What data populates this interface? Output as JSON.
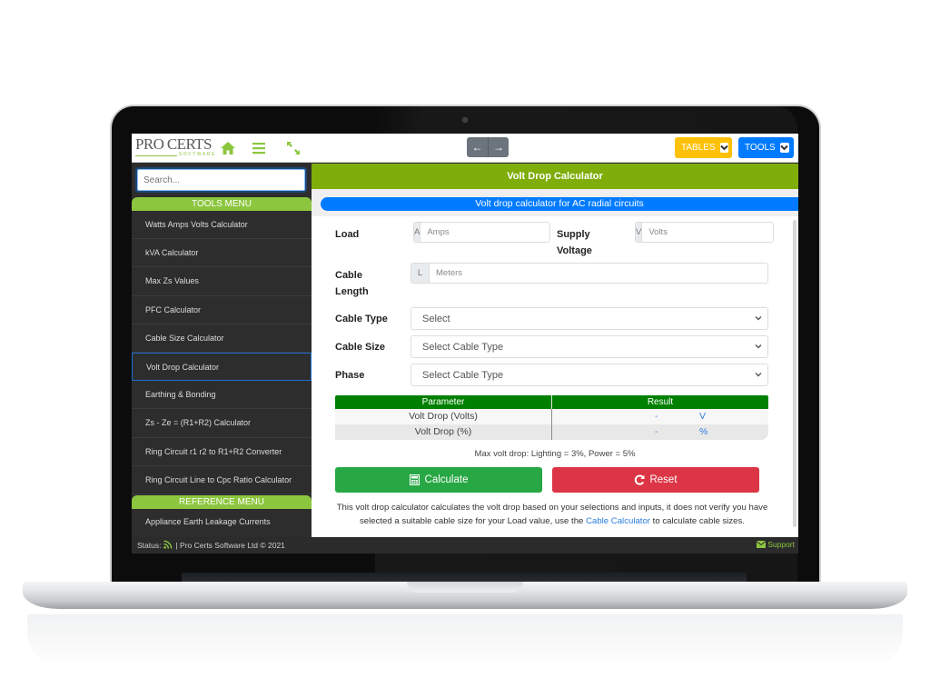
{
  "app": {
    "logo": {
      "title": "PRO CERTS",
      "subtitle": "SOFTWARE"
    },
    "top_icons": [
      "home-icon",
      "hamburger-menu-icon",
      "expand-icon"
    ],
    "nav": {
      "back_label": "←",
      "forward_label": "→"
    },
    "dropdowns": [
      {
        "label": "TABLES",
        "color": "#ffc107"
      },
      {
        "label": "TOOLS",
        "color": "#007bff"
      }
    ]
  },
  "sidebar": {
    "search": {
      "placeholder": "Search...",
      "value": ""
    },
    "tools_header": "TOOLS MENU",
    "tools": [
      {
        "label": "Watts Amps Volts Calculator",
        "active": false
      },
      {
        "label": "kVA Calculator",
        "active": false
      },
      {
        "label": "Max Zs Values",
        "active": false
      },
      {
        "label": "PFC Calculator",
        "active": false
      },
      {
        "label": "Cable Size Calculator",
        "active": false
      },
      {
        "label": "Volt Drop Calculator",
        "active": true
      },
      {
        "label": "Earthing & Bonding",
        "active": false
      },
      {
        "label": "Zs - Ze = (R1+R2) Calculator",
        "active": false
      },
      {
        "label": "Ring Circuit r1 r2 to R1+R2 Converter",
        "active": false
      },
      {
        "label": "Ring Circuit Line to Cpc Ratio Calculator",
        "active": false
      }
    ],
    "reference_header": "REFERENCE MENU",
    "reference": [
      {
        "label": "Appliance Earth Leakage Currents"
      }
    ]
  },
  "statusbar": {
    "status_label": "Status:",
    "copyright": "| Pro Certs Software Ltd © 2021",
    "support_label": "Support"
  },
  "main": {
    "title": "Volt Drop Calculator",
    "subtitle": "Volt drop calculator for AC radial circuits",
    "fields": {
      "load": {
        "label": "Load",
        "addon": "A",
        "placeholder": "Amps",
        "value": ""
      },
      "supply": {
        "label_line1": "Supply",
        "label_line2": "Voltage",
        "addon": "V",
        "placeholder": "Volts",
        "value": ""
      },
      "length": {
        "label_line1": "Cable",
        "label_line2": "Length",
        "addon": "L",
        "placeholder": "Meters",
        "value": ""
      }
    },
    "selects": [
      {
        "label": "Cable Type",
        "value": "Select"
      },
      {
        "label": "Cable Size",
        "value": "Select Cable Type"
      },
      {
        "label": "Phase",
        "value": "Select Cable Type"
      }
    ],
    "results": {
      "headers": [
        "Parameter",
        "Result"
      ],
      "rows": [
        {
          "parameter": "Volt Drop (Volts)",
          "value": "-",
          "unit": "V"
        },
        {
          "parameter": "Volt Drop (%)",
          "value": "-",
          "unit": "%"
        }
      ]
    },
    "note": "Max volt drop: Lighting = 3%, Power = 5%",
    "buttons": {
      "calculate": "Calculate",
      "reset": "Reset"
    },
    "description": {
      "before": "This volt drop calculator calculates the volt drop based on your selections and inputs, it does not verify you have selected a suitable cable size for your Load value, use the ",
      "link": "Cable Calculator",
      "after": " to calculate cable sizes."
    }
  }
}
